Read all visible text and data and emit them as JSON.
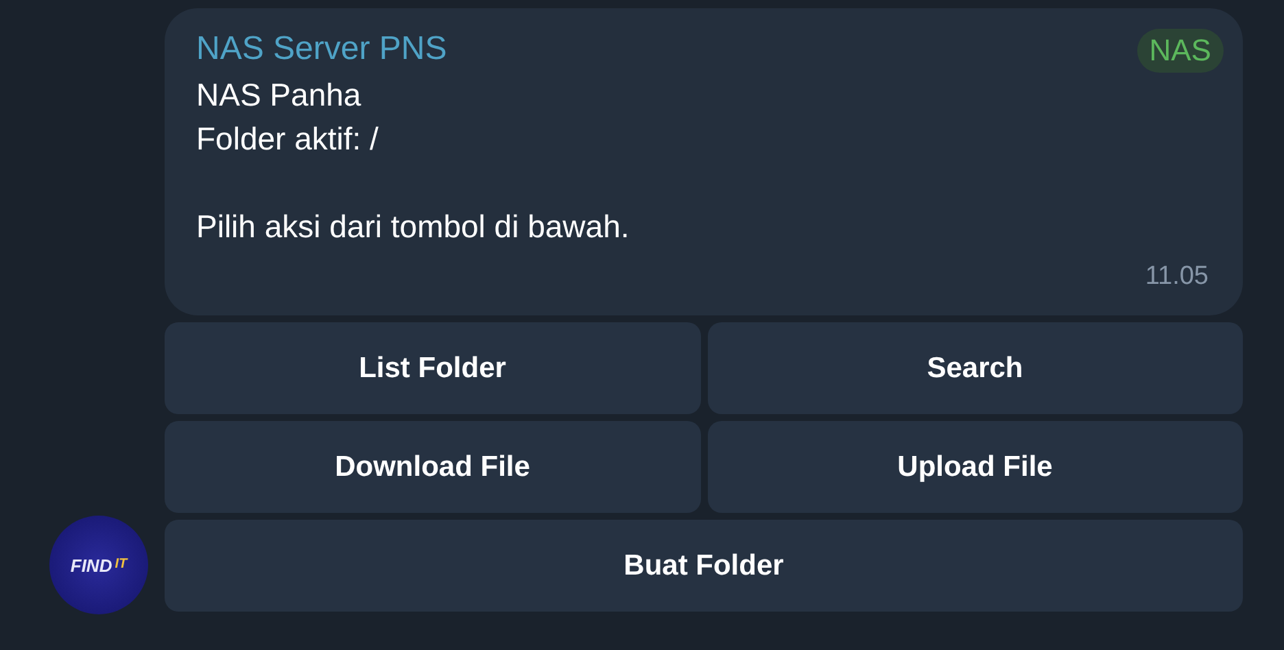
{
  "message": {
    "sender": "NAS Server PNS",
    "tag": "NAS",
    "paragraphs": [
      [
        "NAS Panha",
        "Folder aktif: /"
      ],
      [
        "Pilih aksi dari tombol di bawah."
      ]
    ],
    "time": "11.05"
  },
  "avatar": {
    "logo_words": [
      "FIND",
      "IT"
    ]
  },
  "keyboard": [
    [
      {
        "label": "List Folder"
      },
      {
        "label": "Search"
      }
    ],
    [
      {
        "label": "Download File"
      },
      {
        "label": "Upload File"
      }
    ],
    [
      {
        "label": "Buat Folder"
      }
    ]
  ]
}
